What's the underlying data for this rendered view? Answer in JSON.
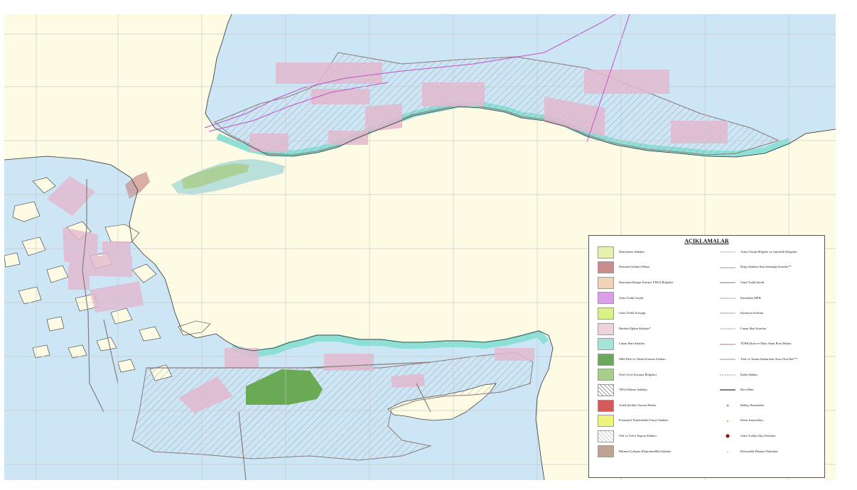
{
  "map": {
    "colors": {
      "sea": "#cde6f5",
      "land": "#fdfbe3",
      "grid": "#c8c8c8",
      "territorial": "#a8dbe8",
      "training_areas": "#e3b9cf",
      "tpao_hatch": "#9a9aa8",
      "marine_park": "#6aaa55",
      "boundary": "#8a7a78",
      "traffic": "#c24fc4",
      "port_zone": "#8ee0d6"
    }
  },
  "legend": {
    "title": "AÇIKLAMALAR",
    "left_items": [
      {
        "label": "Denizlerme Sahaları",
        "color": "#e6f0b0",
        "pattern": "solid"
      },
      {
        "label": "Denizaltı Kültürel Miras",
        "color": "#c98d8d",
        "pattern": "solid"
      },
      {
        "label": "Denizüstü Rüzgar Enerjisi YEKA Bölgeleri",
        "color": "#f3d3b7",
        "pattern": "solid"
      },
      {
        "label": "Gemi Trafik Geçidi",
        "color": "#d9a0e8",
        "pattern": "solid"
      },
      {
        "label": "Gemi Trafik Kavşağı",
        "color": "#d9f28a",
        "pattern": "solid"
      },
      {
        "label": "Hareket Eğitim Sahaları*",
        "color": "#ecd3de",
        "pattern": "solid"
      },
      {
        "label": "Liman İdari Sahaları",
        "color": "#a6e3d9",
        "pattern": "solid"
      },
      {
        "label": "Milli Park ve Tabiat Koruma Alanları",
        "color": "#6aa85a",
        "pattern": "solid"
      },
      {
        "label": "Özel Çevre Koruma Bölgeleri",
        "color": "#a9ce8c",
        "pattern": "solid"
      },
      {
        "label": "TPAO Ruhsat Sahaları",
        "color": "#ffffff",
        "pattern": "hatch"
      },
      {
        "label": "Trafik Şeritleri Ayırım Hatları",
        "color": "#d45a5a",
        "pattern": "solid"
      },
      {
        "label": "Potansiyel Yenilenebilir Enerji Alanları",
        "color": "#eef57a",
        "pattern": "solid"
      },
      {
        "label": "Yük ve Yolcu Taşıma Alanları",
        "color": "#ffffff",
        "pattern": "hatch-light"
      },
      {
        "label": "Bilimsel Çalışma (Depremsellik) Sahaları",
        "color": "#bfa494",
        "pattern": "solid"
      }
    ],
    "right_items": [
      {
        "label": "Askeri Yasak Bölgeler ve Güvenlik Bölgeleri",
        "color": "#b8b8b8",
        "style": "line"
      },
      {
        "label": "Doğu Akdeniz Kıta Sahanlığı Sınırları**",
        "color": "#9a9a9a",
        "style": "line"
      },
      {
        "label": "Gemi Trafik Şeridi",
        "color": "#777777",
        "style": "line"
      },
      {
        "label": "Karadeniz MEB",
        "color": "#b0b0b0",
        "style": "line"
      },
      {
        "label": "Karasuyu Sınırları",
        "color": "#a0a0a0",
        "style": "line"
      },
      {
        "label": "Liman İdari Sınırları",
        "color": "#b4b4b4",
        "style": "line"
      },
      {
        "label": "TÜRKAkım ve Mavi Akım Boru Hatları",
        "color": "#b06fb0",
        "style": "line"
      },
      {
        "label": "Türk ve Yunan Anakaraları Arası Orta Hat***",
        "color": "#8f8f8f",
        "style": "line"
      },
      {
        "label": "Kablo Hatları",
        "color": "#8a8a8a",
        "style": "dash"
      },
      {
        "label": "Boru Hattı",
        "color": "#555555",
        "style": "line-thick"
      },
      {
        "label": "Balıkçı Barınakları",
        "color": "#8fc46a",
        "style": "dot"
      },
      {
        "label": "Deniz İstasyonları",
        "color": "#c8a040",
        "style": "dot-small"
      },
      {
        "label": "Gemi Trafiği Akış Noktaları",
        "color": "#8a1a1a",
        "style": "dot-large"
      },
      {
        "label": "Kılavuzluk Hizmeti Noktaları",
        "color": "#d4d4b8",
        "style": "dot-small"
      }
    ]
  }
}
